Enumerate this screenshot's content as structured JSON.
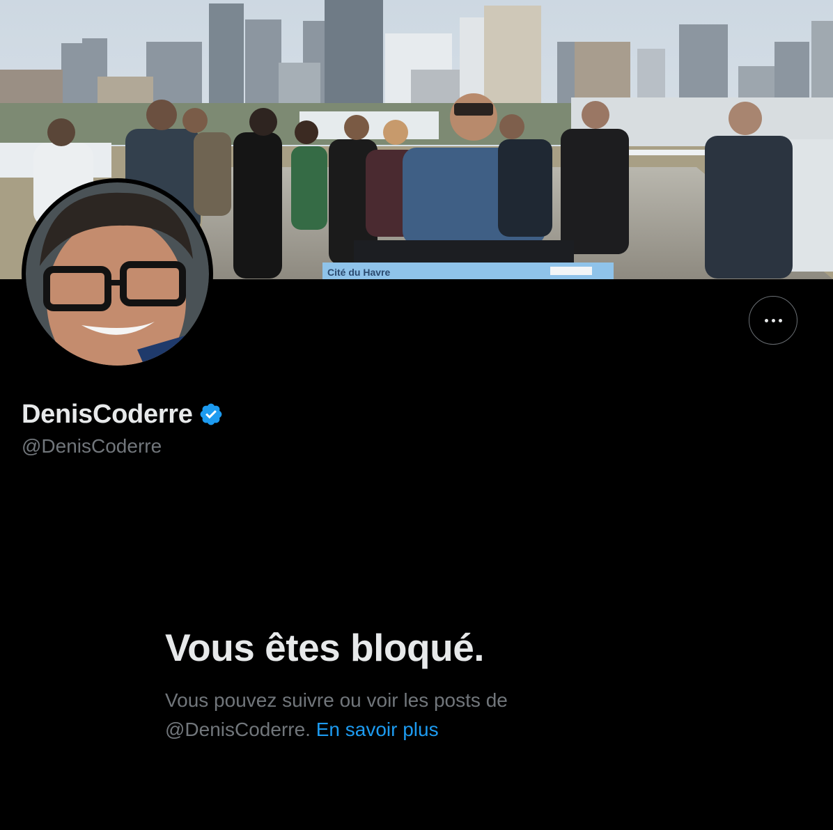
{
  "banner": {
    "sign_text": "Cité du Havre"
  },
  "profile": {
    "display_name": "DenisCoderre",
    "handle": "@DenisCoderre"
  },
  "blocked": {
    "title": "Vous êtes bloqué.",
    "desc_prefix": "Vous pouvez suivre ou voir les posts de",
    "desc_handle": "@DenisCoderre.",
    "learn_more": "En savoir plus"
  },
  "icons": {
    "more": "more-horizontal-icon",
    "verified": "verified-badge-icon"
  },
  "colors": {
    "background": "#000000",
    "primary_text": "#e7e9ea",
    "secondary_text": "#71767b",
    "link": "#1d9bf0",
    "verified": "#1d9bf0"
  }
}
